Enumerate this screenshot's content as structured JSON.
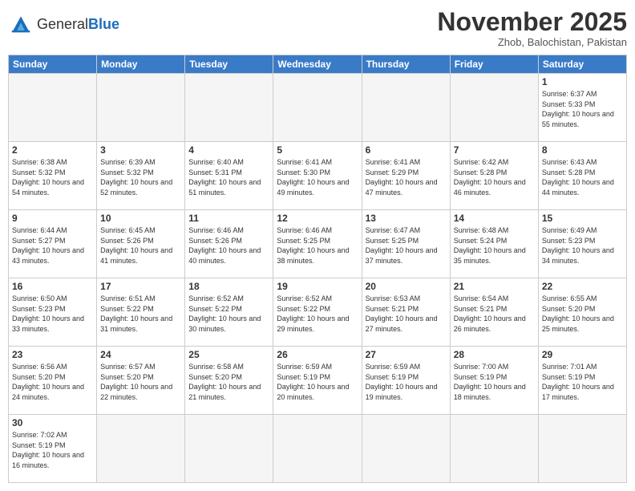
{
  "header": {
    "logo_general": "General",
    "logo_blue": "Blue",
    "month_title": "November 2025",
    "subtitle": "Zhob, Balochistan, Pakistan"
  },
  "days_of_week": [
    "Sunday",
    "Monday",
    "Tuesday",
    "Wednesday",
    "Thursday",
    "Friday",
    "Saturday"
  ],
  "weeks": [
    [
      {
        "day": "",
        "info": ""
      },
      {
        "day": "",
        "info": ""
      },
      {
        "day": "",
        "info": ""
      },
      {
        "day": "",
        "info": ""
      },
      {
        "day": "",
        "info": ""
      },
      {
        "day": "",
        "info": ""
      },
      {
        "day": "1",
        "info": "Sunrise: 6:37 AM\nSunset: 5:33 PM\nDaylight: 10 hours and 55 minutes."
      }
    ],
    [
      {
        "day": "2",
        "info": "Sunrise: 6:38 AM\nSunset: 5:32 PM\nDaylight: 10 hours and 54 minutes."
      },
      {
        "day": "3",
        "info": "Sunrise: 6:39 AM\nSunset: 5:32 PM\nDaylight: 10 hours and 52 minutes."
      },
      {
        "day": "4",
        "info": "Sunrise: 6:40 AM\nSunset: 5:31 PM\nDaylight: 10 hours and 51 minutes."
      },
      {
        "day": "5",
        "info": "Sunrise: 6:41 AM\nSunset: 5:30 PM\nDaylight: 10 hours and 49 minutes."
      },
      {
        "day": "6",
        "info": "Sunrise: 6:41 AM\nSunset: 5:29 PM\nDaylight: 10 hours and 47 minutes."
      },
      {
        "day": "7",
        "info": "Sunrise: 6:42 AM\nSunset: 5:28 PM\nDaylight: 10 hours and 46 minutes."
      },
      {
        "day": "8",
        "info": "Sunrise: 6:43 AM\nSunset: 5:28 PM\nDaylight: 10 hours and 44 minutes."
      }
    ],
    [
      {
        "day": "9",
        "info": "Sunrise: 6:44 AM\nSunset: 5:27 PM\nDaylight: 10 hours and 43 minutes."
      },
      {
        "day": "10",
        "info": "Sunrise: 6:45 AM\nSunset: 5:26 PM\nDaylight: 10 hours and 41 minutes."
      },
      {
        "day": "11",
        "info": "Sunrise: 6:46 AM\nSunset: 5:26 PM\nDaylight: 10 hours and 40 minutes."
      },
      {
        "day": "12",
        "info": "Sunrise: 6:46 AM\nSunset: 5:25 PM\nDaylight: 10 hours and 38 minutes."
      },
      {
        "day": "13",
        "info": "Sunrise: 6:47 AM\nSunset: 5:25 PM\nDaylight: 10 hours and 37 minutes."
      },
      {
        "day": "14",
        "info": "Sunrise: 6:48 AM\nSunset: 5:24 PM\nDaylight: 10 hours and 35 minutes."
      },
      {
        "day": "15",
        "info": "Sunrise: 6:49 AM\nSunset: 5:23 PM\nDaylight: 10 hours and 34 minutes."
      }
    ],
    [
      {
        "day": "16",
        "info": "Sunrise: 6:50 AM\nSunset: 5:23 PM\nDaylight: 10 hours and 33 minutes."
      },
      {
        "day": "17",
        "info": "Sunrise: 6:51 AM\nSunset: 5:22 PM\nDaylight: 10 hours and 31 minutes."
      },
      {
        "day": "18",
        "info": "Sunrise: 6:52 AM\nSunset: 5:22 PM\nDaylight: 10 hours and 30 minutes."
      },
      {
        "day": "19",
        "info": "Sunrise: 6:52 AM\nSunset: 5:22 PM\nDaylight: 10 hours and 29 minutes."
      },
      {
        "day": "20",
        "info": "Sunrise: 6:53 AM\nSunset: 5:21 PM\nDaylight: 10 hours and 27 minutes."
      },
      {
        "day": "21",
        "info": "Sunrise: 6:54 AM\nSunset: 5:21 PM\nDaylight: 10 hours and 26 minutes."
      },
      {
        "day": "22",
        "info": "Sunrise: 6:55 AM\nSunset: 5:20 PM\nDaylight: 10 hours and 25 minutes."
      }
    ],
    [
      {
        "day": "23",
        "info": "Sunrise: 6:56 AM\nSunset: 5:20 PM\nDaylight: 10 hours and 24 minutes."
      },
      {
        "day": "24",
        "info": "Sunrise: 6:57 AM\nSunset: 5:20 PM\nDaylight: 10 hours and 22 minutes."
      },
      {
        "day": "25",
        "info": "Sunrise: 6:58 AM\nSunset: 5:20 PM\nDaylight: 10 hours and 21 minutes."
      },
      {
        "day": "26",
        "info": "Sunrise: 6:59 AM\nSunset: 5:19 PM\nDaylight: 10 hours and 20 minutes."
      },
      {
        "day": "27",
        "info": "Sunrise: 6:59 AM\nSunset: 5:19 PM\nDaylight: 10 hours and 19 minutes."
      },
      {
        "day": "28",
        "info": "Sunrise: 7:00 AM\nSunset: 5:19 PM\nDaylight: 10 hours and 18 minutes."
      },
      {
        "day": "29",
        "info": "Sunrise: 7:01 AM\nSunset: 5:19 PM\nDaylight: 10 hours and 17 minutes."
      }
    ],
    [
      {
        "day": "30",
        "info": "Sunrise: 7:02 AM\nSunset: 5:19 PM\nDaylight: 10 hours and 16 minutes."
      },
      {
        "day": "",
        "info": ""
      },
      {
        "day": "",
        "info": ""
      },
      {
        "day": "",
        "info": ""
      },
      {
        "day": "",
        "info": ""
      },
      {
        "day": "",
        "info": ""
      },
      {
        "day": "",
        "info": ""
      }
    ]
  ]
}
